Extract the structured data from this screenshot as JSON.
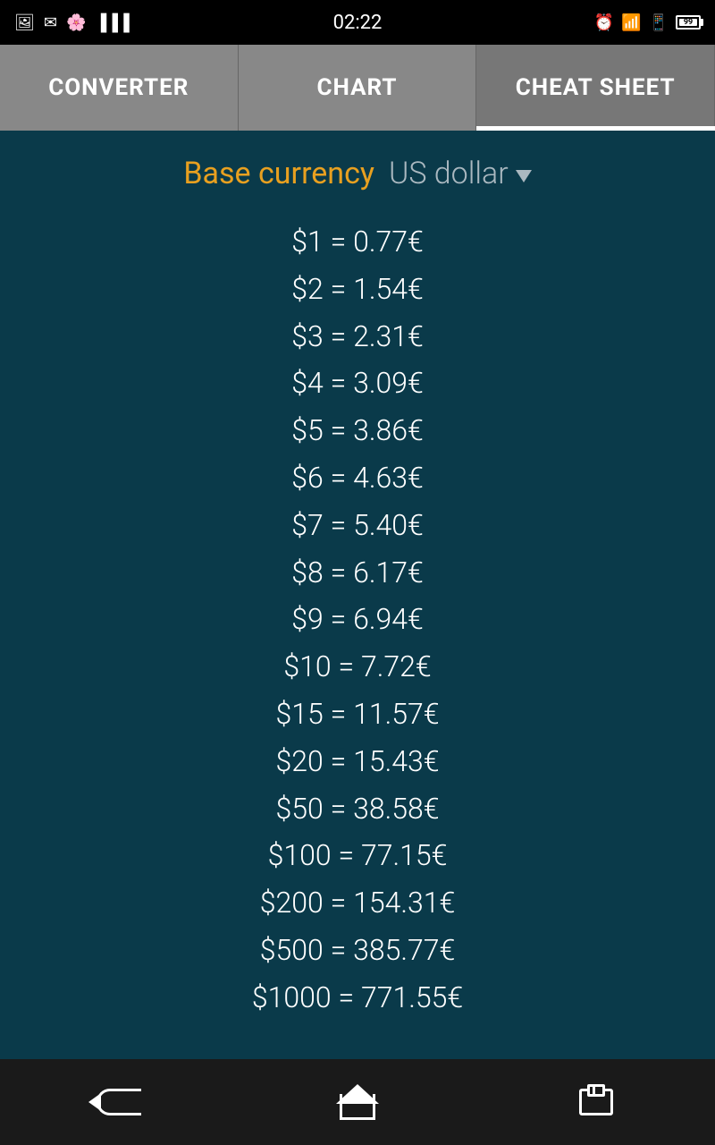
{
  "statusBar": {
    "time": "02:22"
  },
  "tabs": [
    {
      "id": "converter",
      "label": "CONVERTER",
      "active": false
    },
    {
      "id": "chart",
      "label": "CHART",
      "active": false
    },
    {
      "id": "cheat-sheet",
      "label": "CHEAT SHEET",
      "active": true
    }
  ],
  "cheatSheet": {
    "baseCurrencyLabel": "Base currency",
    "currencyName": "US dollar",
    "conversions": [
      {
        "from": "$1",
        "to": "0.77€"
      },
      {
        "from": "$2",
        "to": "1.54€"
      },
      {
        "from": "$3",
        "to": "2.31€"
      },
      {
        "from": "$4",
        "to": "3.09€"
      },
      {
        "from": "$5",
        "to": "3.86€"
      },
      {
        "from": "$6",
        "to": "4.63€"
      },
      {
        "from": "$7",
        "to": "5.40€"
      },
      {
        "from": "$8",
        "to": "6.17€"
      },
      {
        "from": "$9",
        "to": "6.94€"
      },
      {
        "from": "$10",
        "to": "7.72€"
      },
      {
        "from": "$15",
        "to": "11.57€"
      },
      {
        "from": "$20",
        "to": "15.43€"
      },
      {
        "from": "$50",
        "to": "38.58€"
      },
      {
        "from": "$100",
        "to": "77.15€"
      },
      {
        "from": "$200",
        "to": "154.31€"
      },
      {
        "from": "$500",
        "to": "385.77€"
      },
      {
        "from": "$1000",
        "to": "771.55€"
      }
    ]
  }
}
